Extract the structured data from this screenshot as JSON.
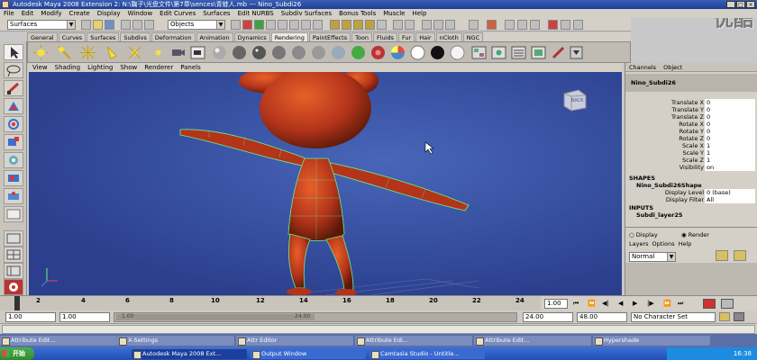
{
  "window": {
    "title": "Autodesk Maya 2008 Extension 2: N:\\鞠子\\光盘文件\\第7章\\sences\\青蛙人.mb  ---  Nino_Subdi26",
    "minimize": "_",
    "maximize": "□",
    "close": "×"
  },
  "watermark": "优酷",
  "menubar": [
    "File",
    "Edit",
    "Modify",
    "Create",
    "Display",
    "Window",
    "Edit Curves",
    "Surfaces",
    "Edit NURBS",
    "Subdiv Surfaces",
    "Bonus Tools",
    "Muscle",
    "Help"
  ],
  "toolbar": {
    "menuset": "Surfaces",
    "selection_mask": "Objects"
  },
  "shelf": {
    "tabs": [
      "General",
      "Curves",
      "Surfaces",
      "Subdivs",
      "Deformation",
      "Animation",
      "Dynamics",
      "Rendering",
      "PaintEffects",
      "Toon",
      "Fluids",
      "Fur",
      "Hair",
      "nCloth",
      "NGC"
    ],
    "active_tab": "Rendering"
  },
  "panel_menu": [
    "View",
    "Shading",
    "Lighting",
    "Show",
    "Renderer",
    "Panels"
  ],
  "viewcube": {
    "label": "BACK"
  },
  "channel_box": {
    "tabs": [
      "Channels",
      "Object"
    ],
    "object_name": "Nino_Subdi26",
    "attributes": [
      {
        "label": "Translate X",
        "value": "0"
      },
      {
        "label": "Translate Y",
        "value": "0"
      },
      {
        "label": "Translate Z",
        "value": "0"
      },
      {
        "label": "Rotate X",
        "value": "0"
      },
      {
        "label": "Rotate Y",
        "value": "0"
      },
      {
        "label": "Rotate Z",
        "value": "0"
      },
      {
        "label": "Scale X",
        "value": "1"
      },
      {
        "label": "Scale Y",
        "value": "1"
      },
      {
        "label": "Scale Z",
        "value": "1"
      },
      {
        "label": "Visibility",
        "value": "on"
      }
    ],
    "shapes_header": "SHAPES",
    "shape_name": "Nino_Subdi26Shape",
    "shape_attrs": [
      {
        "label": "Display Level",
        "value": "0 (base)"
      },
      {
        "label": "Display Filter",
        "value": "All"
      }
    ],
    "inputs_header": "INPUTS",
    "input_name": "Subdi_layer25"
  },
  "layer_editor": {
    "display_radio": "Display",
    "render_radio": "Render",
    "menus": [
      "Layers",
      "Options",
      "Help"
    ],
    "layer_type": "Normal"
  },
  "timeline": {
    "ticks": [
      "2",
      "4",
      "6",
      "8",
      "10",
      "12",
      "14",
      "16",
      "18",
      "20",
      "22",
      "24"
    ],
    "current_frame": "1"
  },
  "range": {
    "start_time": "1.00",
    "playback_start": "1.00",
    "range_left": "1.00",
    "range_right": "24.00",
    "playback_end": "24.00",
    "end_time": "48.00",
    "character_set": "No Character Set",
    "current_time": "1.00"
  },
  "minimized_windows": [
    "Attribute Edit...",
    "Attribute Edit...",
    "",
    "X-Settings",
    "Attr Editor",
    "Attribute Edi...",
    "Attribute Edit...",
    "Hypershade"
  ],
  "taskbar": {
    "start": "开始",
    "items": [
      "Autodesk Maya 2008 Ext...",
      "Output Window",
      "Camtasia Studio - Untitle..."
    ],
    "clock": "16:38"
  }
}
